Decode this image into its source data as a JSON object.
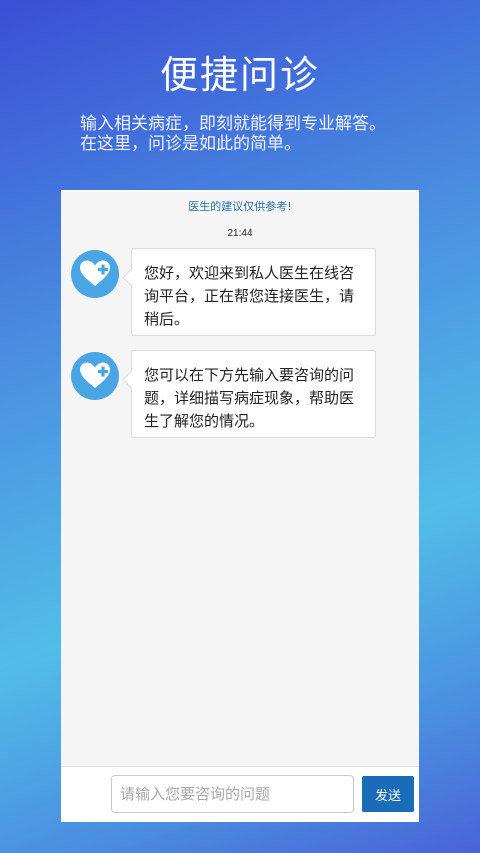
{
  "hero": {
    "title": "便捷问诊",
    "subtitle_line1": "输入相关病症，即刻就能得到专业解答。",
    "subtitle_line2": "在这里，问诊是如此的简单。"
  },
  "chat": {
    "disclaimer": "医生的建议仅供参考!",
    "timestamp": "21:44",
    "messages": [
      {
        "avatar_icon": "heart-medical-icon",
        "text": "您好，欢迎来到私人医生在线咨询平台，正在帮您连接医生，请稍后。"
      },
      {
        "avatar_icon": "heart-medical-icon",
        "text": "您可以在下方先输入要咨询的问题，详细描写病症现象，帮助医生了解您的情况。"
      }
    ]
  },
  "composer": {
    "placeholder": "请输入您要咨询的问题",
    "value": "",
    "send_label": "发送"
  },
  "colors": {
    "accent": "#1a6cb8",
    "avatar": "#4aa5e4",
    "disclaimer_text": "#2a6ea8"
  }
}
